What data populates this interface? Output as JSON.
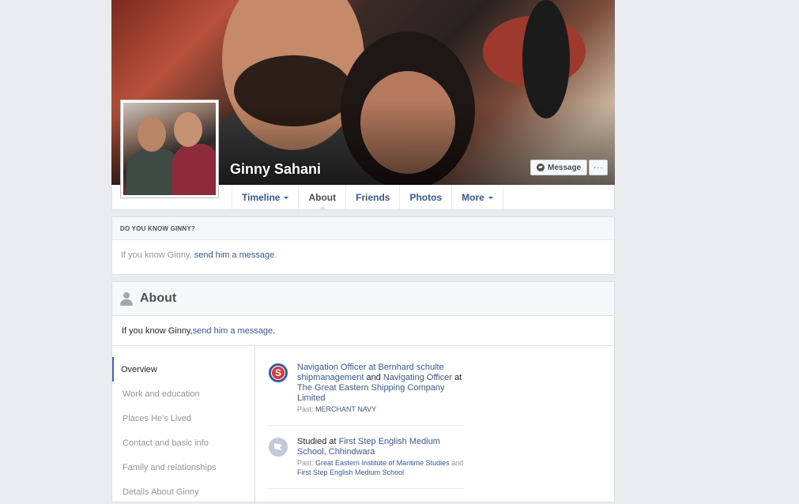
{
  "profile": {
    "name": "Ginny Sahani",
    "message_label": "Message",
    "more_label": "···"
  },
  "tabs": [
    {
      "label": "Timeline",
      "dropdown": true
    },
    {
      "label": "About",
      "active": true
    },
    {
      "label": "Friends"
    },
    {
      "label": "Photos"
    },
    {
      "label": "More",
      "dropdown": true
    }
  ],
  "know_card": {
    "heading": "DO YOU KNOW GINNY?",
    "prefix": "If you know Ginny, ",
    "link": "send him a message",
    "suffix": "."
  },
  "about": {
    "title": "About",
    "know_prefix": "If you know Ginny, ",
    "know_link": "send him a message",
    "know_suffix": ".",
    "nav": [
      {
        "label": "Overview",
        "active": true
      },
      {
        "label": "Work and education"
      },
      {
        "label": "Places He's Lived"
      },
      {
        "label": "Contact and basic info"
      },
      {
        "label": "Family and relationships"
      },
      {
        "label": "Details About Ginny"
      }
    ],
    "work": {
      "icon": "company-logo-icon",
      "p1": "Navigation Officer at ",
      "link1": "Bernhard schulte shipmanagement",
      "p2": " and ",
      "link2": "Navigating Officer",
      "p3": " at ",
      "link3": "The Great Eastern Shipping Company Limited",
      "past_label": "Past: ",
      "past_link": "MERCHANT NAVY"
    },
    "education": {
      "icon": "school-icon",
      "p1": "Studied at ",
      "link1": "First Step English Medium School, Chhindwara",
      "past_label": "Past: ",
      "past_link1": "Great Eastern Institute of Maritime Studies",
      "past_mid": " and ",
      "past_link2": "First Step English Medium School"
    }
  },
  "colors": {
    "page_bg": "#e9ebee",
    "link": "#365899",
    "active_indicator": "#4267b2"
  }
}
